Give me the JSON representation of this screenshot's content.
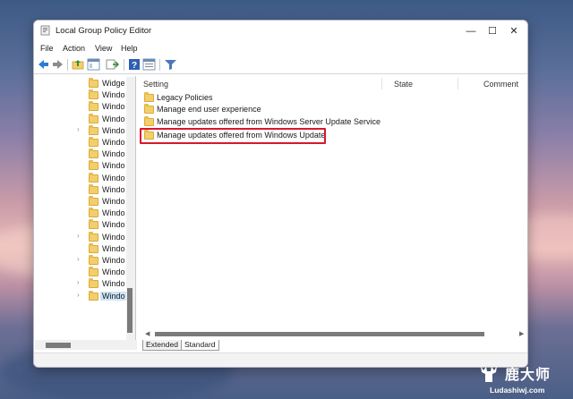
{
  "window": {
    "title": "Local Group Policy Editor",
    "controls": {
      "minimize": "—",
      "maximize": "☐",
      "close": "✕"
    }
  },
  "menubar": {
    "items": [
      "File",
      "Action",
      "View",
      "Help"
    ]
  },
  "toolbar": {
    "icons": [
      "back-arrow-icon",
      "forward-arrow-icon",
      "up-folder-icon",
      "show-hide-tree-icon",
      "export-list-icon",
      "help-icon",
      "properties-icon",
      "filter-icon"
    ]
  },
  "tree": {
    "rows": [
      {
        "label": "Widge",
        "expandable": false
      },
      {
        "label": "Windo",
        "expandable": false
      },
      {
        "label": "Windo",
        "expandable": false
      },
      {
        "label": "Windo",
        "expandable": false
      },
      {
        "label": "Windo",
        "expandable": true
      },
      {
        "label": "Windo",
        "expandable": false
      },
      {
        "label": "Windo",
        "expandable": false
      },
      {
        "label": "Windo",
        "expandable": false
      },
      {
        "label": "Windo",
        "expandable": false
      },
      {
        "label": "Windo",
        "expandable": false
      },
      {
        "label": "Windo",
        "expandable": false
      },
      {
        "label": "Windo",
        "expandable": false
      },
      {
        "label": "Windo",
        "expandable": false
      },
      {
        "label": "Windo",
        "expandable": true
      },
      {
        "label": "Windo",
        "expandable": false
      },
      {
        "label": "Windo",
        "expandable": true
      },
      {
        "label": "Windo",
        "expandable": false
      },
      {
        "label": "Windo",
        "expandable": true
      },
      {
        "label": "Windo",
        "expandable": true
      }
    ],
    "selected_index": 18
  },
  "list": {
    "columns": [
      "Setting",
      "State",
      "Comment"
    ],
    "items": [
      "Legacy Policies",
      "Manage end user experience",
      "Manage updates offered from Windows Server Update Service",
      "Manage updates offered from Windows Update"
    ],
    "highlighted_index": 3
  },
  "tabs": [
    "Extended",
    "Standard"
  ],
  "watermark": {
    "cn": "鹿大师",
    "en": "Ludashiwj.com"
  },
  "colors": {
    "highlight": "#d8182b",
    "folder": "#f3cf6b",
    "selection": "#cce4f7"
  }
}
